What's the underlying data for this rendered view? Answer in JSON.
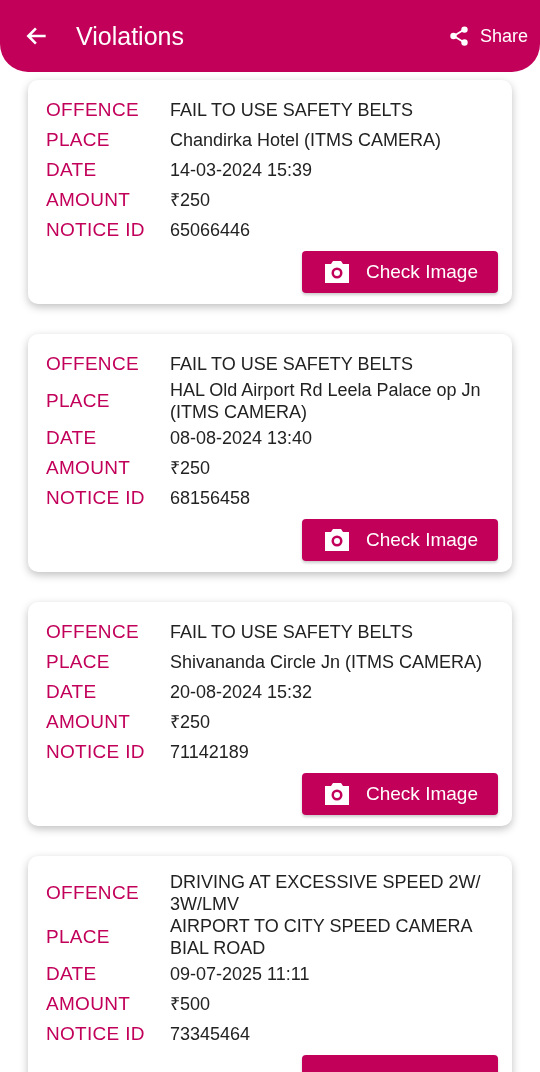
{
  "header": {
    "title": "Violations",
    "share_label": "Share"
  },
  "violations": [
    {
      "rows": [
        {
          "label": "OFFENCE",
          "value": "FAIL TO USE SAFETY BELTS"
        },
        {
          "label": "PLACE",
          "value": "Chandirka Hotel (ITMS CAMERA)"
        },
        {
          "label": "DATE",
          "value": "14-03-2024 15:39"
        },
        {
          "label": "AMOUNT",
          "value": "₹250"
        },
        {
          "label": "NOTICE ID",
          "value": "65066446"
        }
      ],
      "button": "Check Image"
    },
    {
      "rows": [
        {
          "label": "OFFENCE",
          "value": "FAIL TO USE SAFETY BELTS"
        },
        {
          "label": "PLACE",
          "value": "HAL Old Airport Rd Leela Palace op Jn (ITMS CAMERA)"
        },
        {
          "label": "DATE",
          "value": "08-08-2024 13:40"
        },
        {
          "label": "AMOUNT",
          "value": "₹250"
        },
        {
          "label": "NOTICE ID",
          "value": "68156458"
        }
      ],
      "button": "Check Image"
    },
    {
      "rows": [
        {
          "label": "OFFENCE",
          "value": "FAIL TO USE SAFETY BELTS"
        },
        {
          "label": "PLACE",
          "value": "Shivananda Circle Jn (ITMS CAMERA)"
        },
        {
          "label": "DATE",
          "value": "20-08-2024 15:32"
        },
        {
          "label": "AMOUNT",
          "value": "₹250"
        },
        {
          "label": "NOTICE ID",
          "value": "71142189"
        }
      ],
      "button": "Check Image"
    },
    {
      "rows": [
        {
          "label": "OFFENCE",
          "value": "DRIVING AT EXCESSIVE SPEED 2W/ 3W/LMV"
        },
        {
          "label": "PLACE",
          "value": "AIRPORT TO CITY SPEED CAMERA BIAL ROAD"
        },
        {
          "label": "DATE",
          "value": "09-07-2025 11:11"
        },
        {
          "label": "AMOUNT",
          "value": "₹500"
        },
        {
          "label": "NOTICE ID",
          "value": "73345464"
        }
      ]
    }
  ]
}
